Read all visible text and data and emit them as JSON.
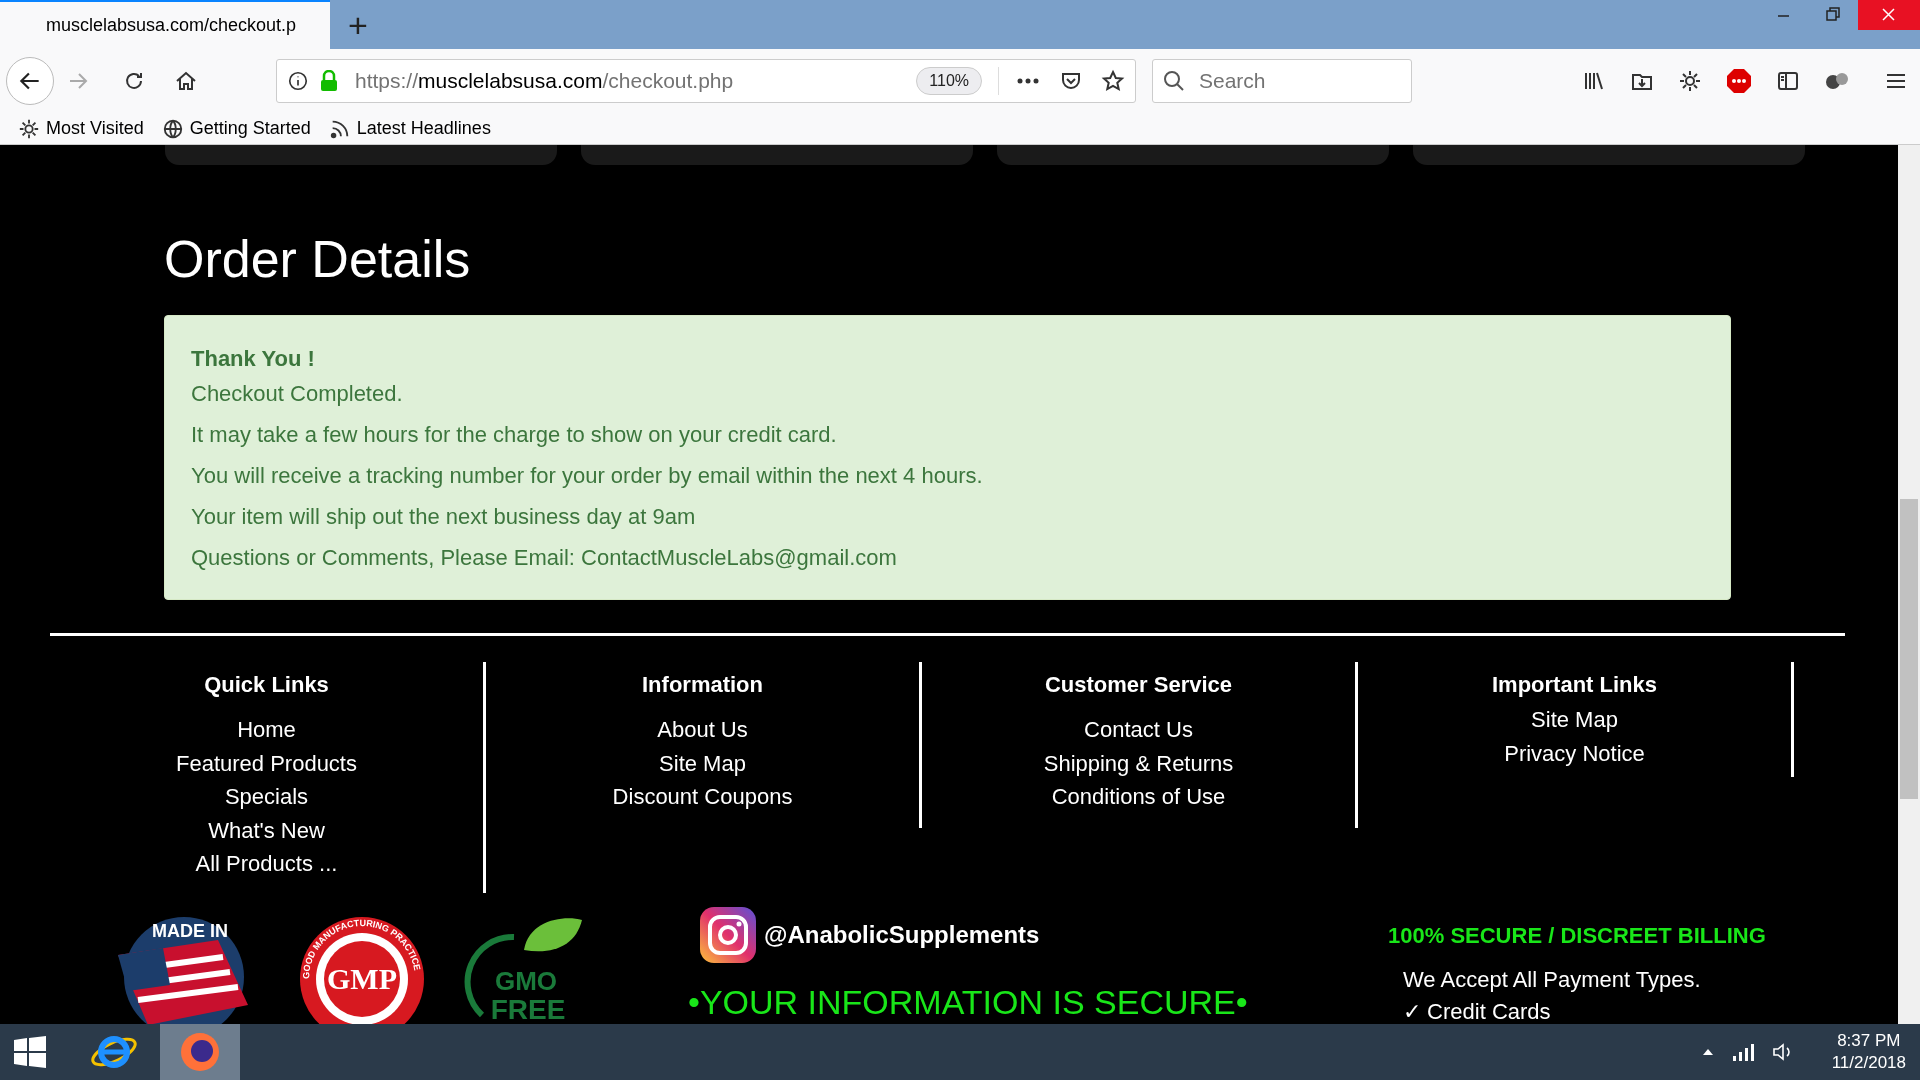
{
  "browser": {
    "tab": {
      "title": "musclelabsusa.com/checkout.p",
      "selected": true
    },
    "new_tab": "+",
    "url": {
      "scheme": "https://",
      "host": "musclelabsusa.com",
      "path": "/checkout.php"
    },
    "zoom": "110%",
    "search": {
      "placeholder": "Search"
    },
    "bookmarks": [
      {
        "label": "Most Visited",
        "kind": "gear"
      },
      {
        "label": "Getting Started",
        "kind": "globe"
      },
      {
        "label": "Latest Headlines",
        "kind": "feed"
      }
    ]
  },
  "page": {
    "heading": "Order Details",
    "alert": {
      "title": "Thank You !",
      "lines": [
        "Checkout Completed.",
        "It may take a few hours for the charge to show on your credit card.",
        "You will receive a tracking number for your order by email within the next 4 hours.",
        "Your item will ship out the next business day at 9am",
        "Questions or Comments, Please Email: ContactMuscleLabs@gmail.com"
      ]
    },
    "footer": {
      "columns": [
        {
          "heading": "Quick Links",
          "links": [
            "Home",
            "Featured Products",
            "Specials",
            "What's New",
            "All Products ..."
          ]
        },
        {
          "heading": "Information",
          "links": [
            "About Us",
            "Site Map",
            "Discount Coupons"
          ]
        },
        {
          "heading": "Customer Service",
          "links": [
            "Contact Us",
            "Shipping & Returns",
            "Conditions of Use"
          ]
        },
        {
          "heading": "Important Links",
          "links": [
            "Site Map",
            "Privacy Notice"
          ]
        }
      ],
      "badges": {
        "made_in": "MADE IN",
        "gmp": "GMP",
        "gmp_ring": "GOOD MANUFACTURING PRACTICE",
        "gmo": "GMO",
        "free": "FREE"
      },
      "instagram": "@AnabolicSupplements",
      "secure": "•YOUR INFORMATION IS SECURE•",
      "billing": "100% SECURE / DISCREET BILLING",
      "payment_note": "We Accept All Payment Types.",
      "payment_item": "✓ Credit Cards"
    }
  },
  "taskbar": {
    "time": "8:37 PM",
    "date": "11/2/2018"
  }
}
